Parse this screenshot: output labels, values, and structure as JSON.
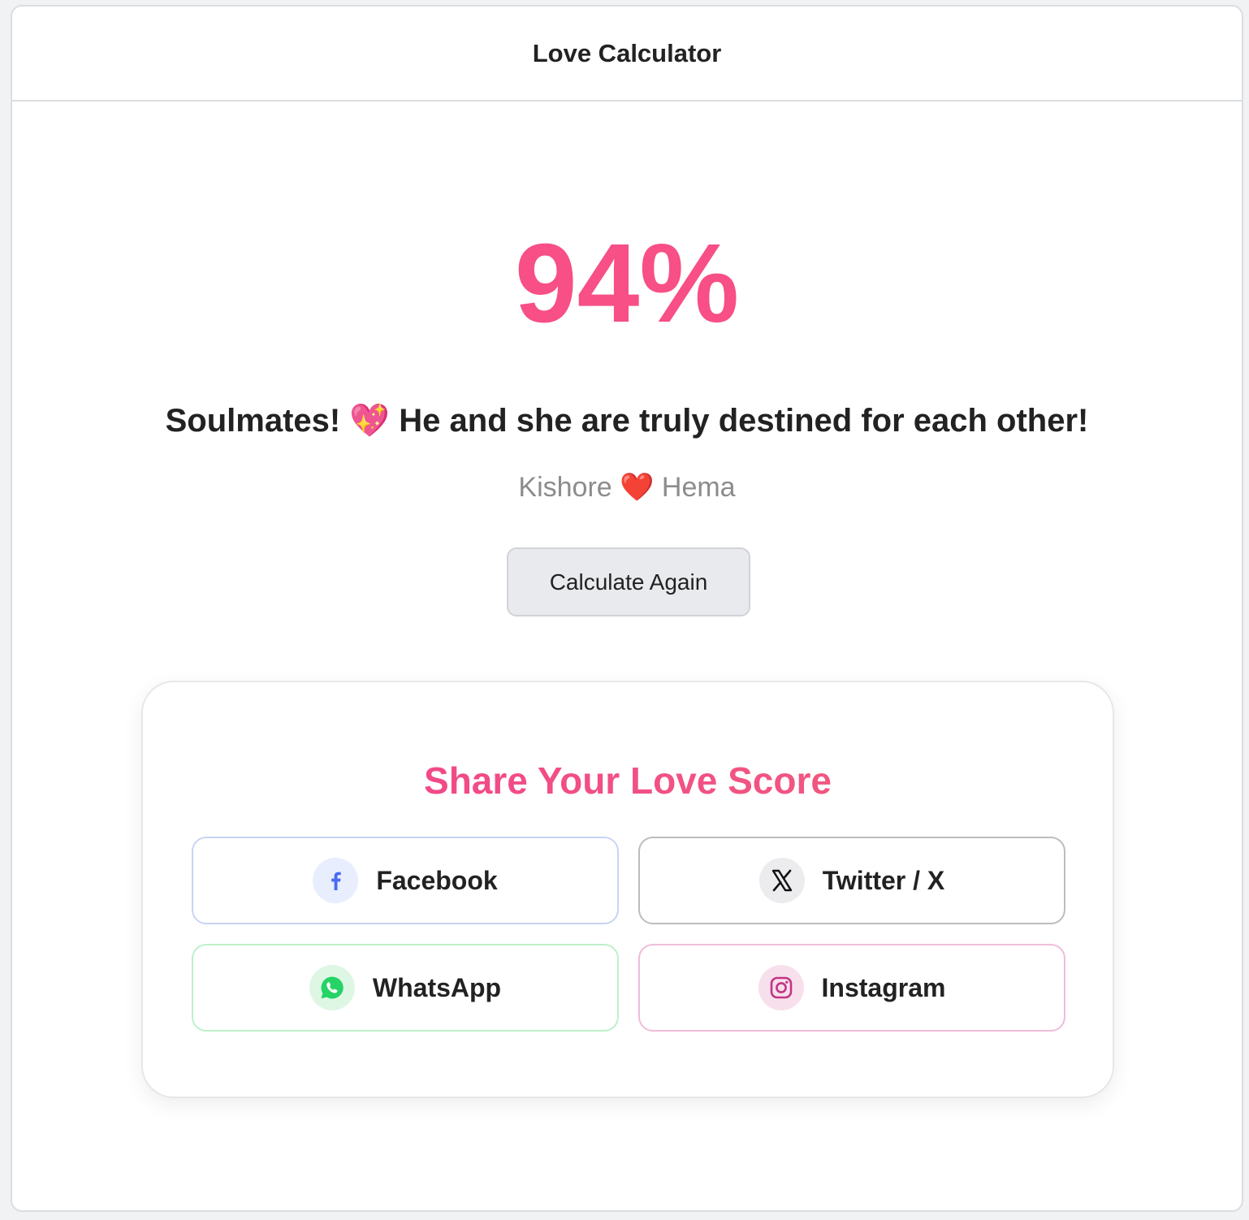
{
  "header": {
    "title": "Love Calculator"
  },
  "result": {
    "score": "94%",
    "message": "Soulmates! 💖 He and she are truly destined for each other!",
    "names": "Kishore ❤️ Hema"
  },
  "actions": {
    "calculate_again_label": "Calculate Again"
  },
  "share": {
    "title": "Share Your Love Score",
    "buttons": {
      "facebook": {
        "label": "Facebook",
        "icon": "facebook-icon",
        "color": "#4a6cf0"
      },
      "twitter": {
        "label": "Twitter / X",
        "icon": "x-icon",
        "color": "#111111"
      },
      "whatsapp": {
        "label": "WhatsApp",
        "icon": "whatsapp-icon",
        "color": "#25d366"
      },
      "instagram": {
        "label": "Instagram",
        "icon": "instagram-icon",
        "color": "#c13584"
      }
    }
  },
  "colors": {
    "accent": "#f74f86",
    "share_title_gradient_start": "#f2408f",
    "share_title_gradient_end": "#f0607a"
  }
}
